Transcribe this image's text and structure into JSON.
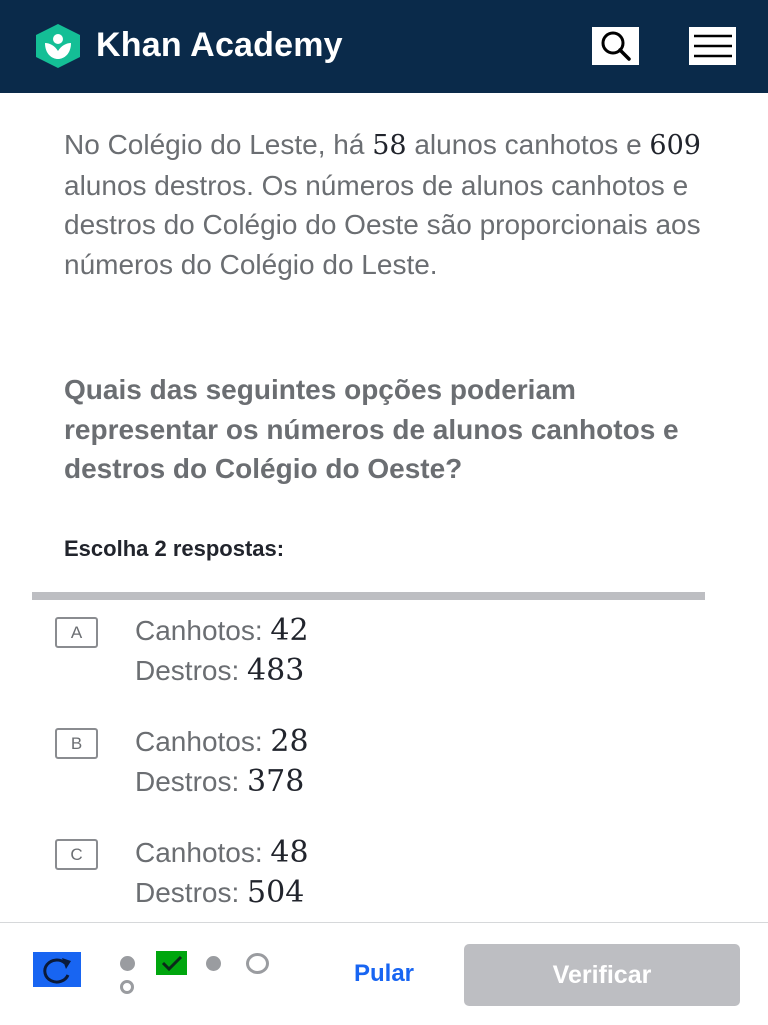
{
  "header": {
    "brand": "Khan Academy",
    "logo_icon": "khan-academy-leaf-logo",
    "search_icon": "search-icon",
    "menu_icon": "hamburger-menu-icon",
    "bg_color": "#0a2a4a"
  },
  "question": {
    "p1": "No Colégio do Leste, há ",
    "n1": "58",
    "p2": " alunos canhotos e ",
    "n2": "609",
    "p3": " alunos destros. Os números de alunos canhotos e destros do Colégio do Oeste são proporcionais aos números do Colégio do Leste."
  },
  "prompt": "Quais das seguintes opções poderiam representar os números de alunos canhotos e destros do Colégio do Oeste?",
  "instruction": "Escolha 2 respostas:",
  "choices": [
    {
      "letter": "A",
      "left_label": "Canhotos: ",
      "left_value": "42",
      "right_label": "Destros: ",
      "right_value": "483"
    },
    {
      "letter": "B",
      "left_label": "Canhotos: ",
      "left_value": "28",
      "right_label": "Destros: ",
      "right_value": "378"
    },
    {
      "letter": "C",
      "left_label": "Canhotos: ",
      "left_value": "48",
      "right_label": "Destros: ",
      "right_value": "504"
    }
  ],
  "footer": {
    "skip_label": "Pular",
    "verify_label": "Verificar",
    "accent_color": "#1865f2",
    "correct_color": "#00a60e"
  }
}
